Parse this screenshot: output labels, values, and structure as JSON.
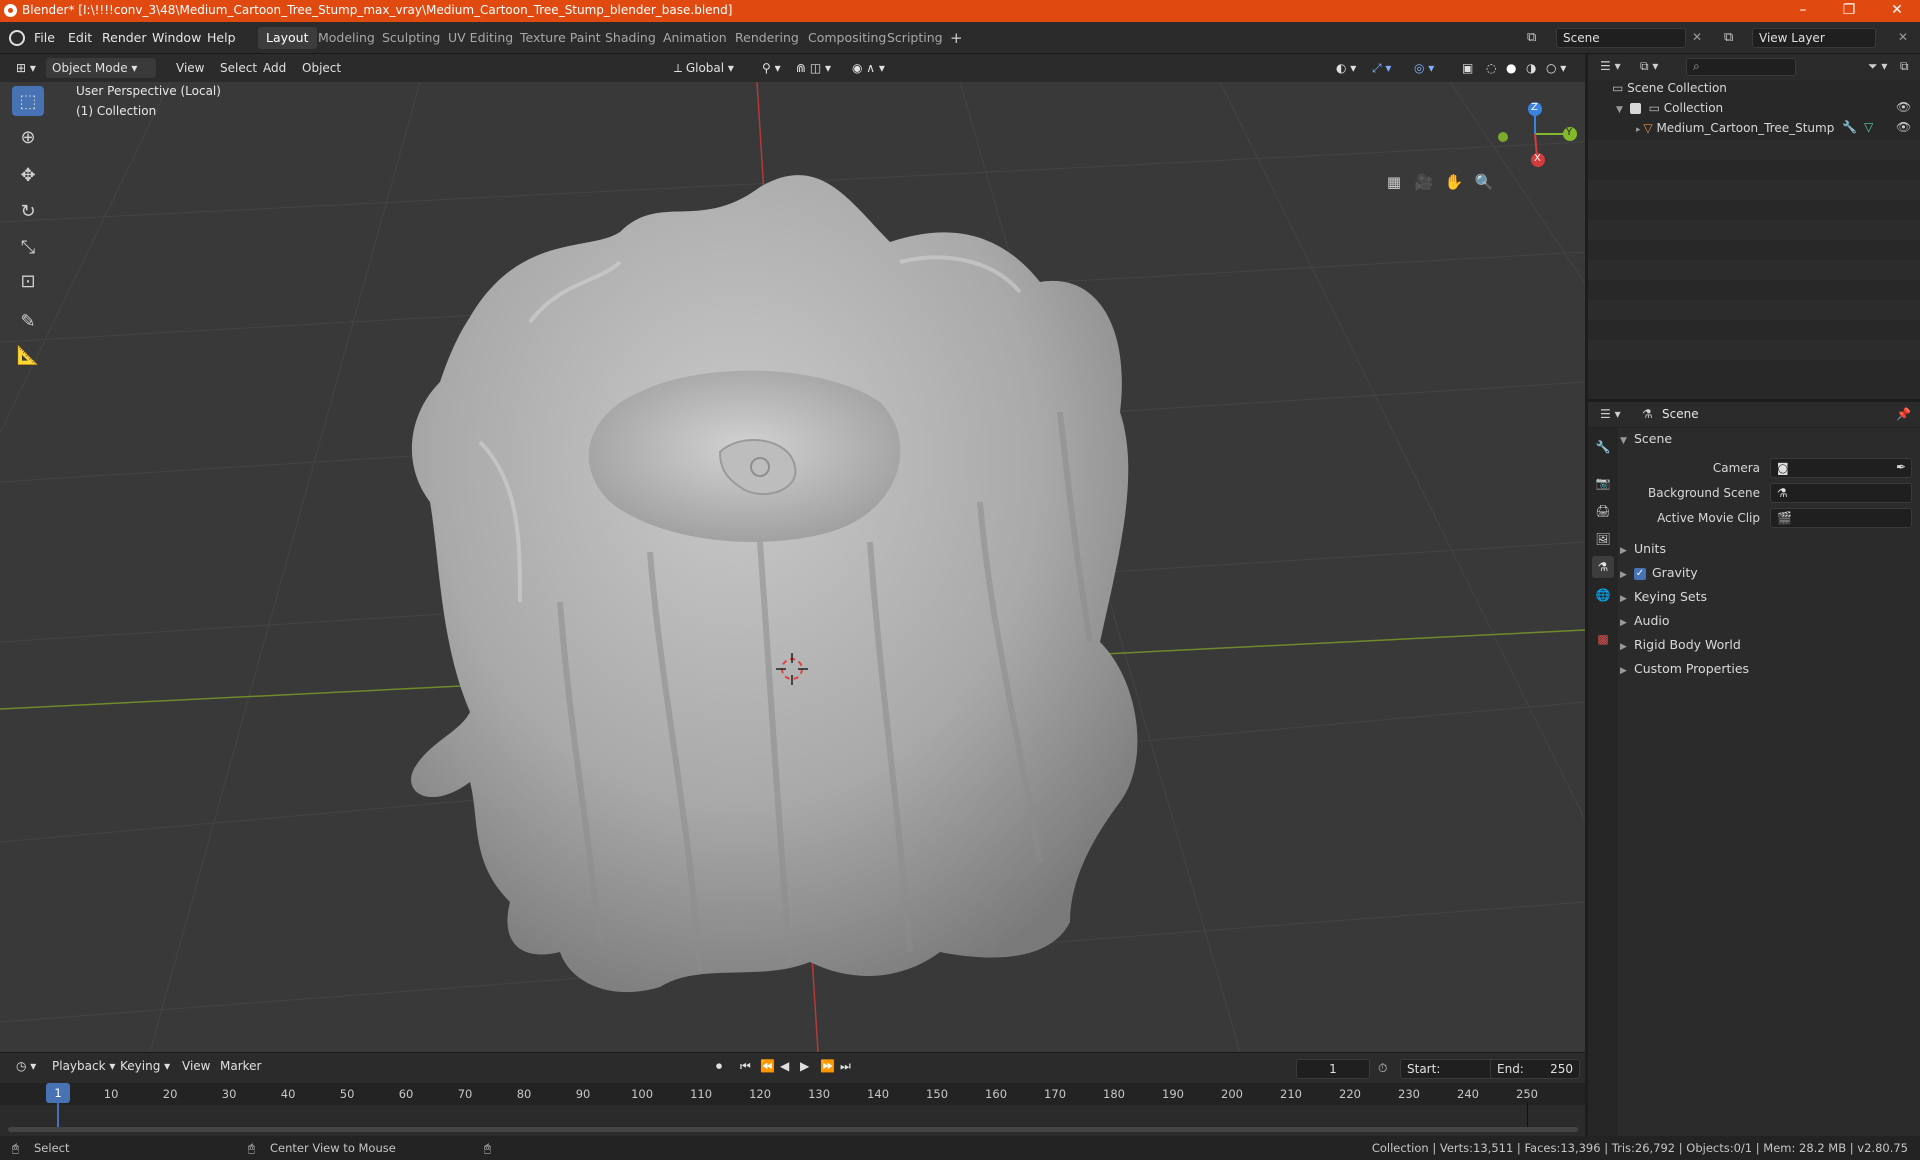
{
  "window": {
    "title": "Blender* [I:\\!!!!conv_3\\48\\Medium_Cartoon_Tree_Stump_max_vray\\Medium_Cartoon_Tree_Stump_blender_base.blend]",
    "minimize": "–",
    "maximize": "❐",
    "close": "✕"
  },
  "menubar": {
    "items": [
      "File",
      "Edit",
      "Render",
      "Window",
      "Help"
    ]
  },
  "workspaces": [
    "Layout",
    "Modeling",
    "Sculpting",
    "UV Editing",
    "Texture Paint",
    "Shading",
    "Animation",
    "Rendering",
    "Compositing",
    "Scripting"
  ],
  "workspace_add": "+",
  "scene_field": "Scene",
  "view_layer_field": "View Layer",
  "viewport_header": {
    "mode": "Object Mode",
    "menus": [
      "View",
      "Select",
      "Add",
      "Object"
    ],
    "orientation": "Global"
  },
  "viewport": {
    "perspective_label": "User Perspective (Local)",
    "collection_label": "(1) Collection",
    "gizmo": {
      "x": "X",
      "y": "Y",
      "z": "Z"
    }
  },
  "outliner": {
    "scene_collection": "Scene Collection",
    "collection": "Collection",
    "object": "Medium_Cartoon_Tree_Stump"
  },
  "properties": {
    "header": "Scene",
    "panel": "Scene",
    "fields": [
      {
        "label": "Camera"
      },
      {
        "label": "Background Scene"
      },
      {
        "label": "Active Movie Clip"
      }
    ],
    "sections": [
      "Units",
      "Gravity",
      "Keying Sets",
      "Audio",
      "Rigid Body World",
      "Custom Properties"
    ],
    "gravity_checked": true
  },
  "timeline": {
    "menus": [
      "Playback",
      "Keying",
      "View",
      "Marker"
    ],
    "current_frame": "1",
    "start_label": "Start:",
    "start": "1",
    "end_label": "End:",
    "end": "250",
    "ticks": [
      "1",
      "10",
      "20",
      "30",
      "40",
      "50",
      "60",
      "70",
      "80",
      "90",
      "100",
      "110",
      "120",
      "130",
      "140",
      "150",
      "160",
      "170",
      "180",
      "190",
      "200",
      "210",
      "220",
      "230",
      "240",
      "250"
    ]
  },
  "statusbar": {
    "left": "Select",
    "middle": "Center View to Mouse",
    "right": "Collection | Verts:13,511 | Faces:13,396 | Tris:26,792 | Objects:0/1 | Mem: 28.2 MB | v2.80.75"
  },
  "colors": {
    "titlebar": "#e04a11",
    "active_tool": "#4772b3",
    "axis_x": "#d43b3b",
    "axis_y": "#82b82c",
    "axis_z": "#3a83e0"
  }
}
